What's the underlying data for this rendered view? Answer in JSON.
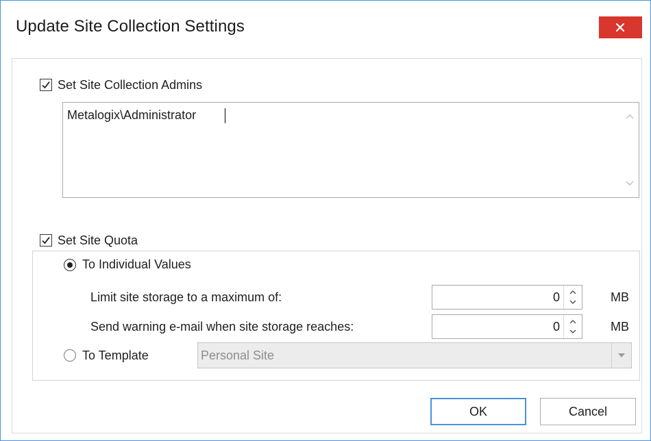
{
  "dialog": {
    "title": "Update Site Collection Settings",
    "close_label": "×"
  },
  "admins": {
    "checkbox_label": "Set Site Collection Admins",
    "checked": true,
    "value": "Metalogix\\Administrator"
  },
  "quota": {
    "checkbox_label": "Set Site Quota",
    "checked": true,
    "individual": {
      "label": "To Individual Values",
      "selected": true,
      "storage_limit_label": "Limit site storage to a maximum of:",
      "storage_limit_value": "0",
      "storage_limit_unit": "MB",
      "warning_label": "Send warning e-mail when site storage reaches:",
      "warning_value": "0",
      "warning_unit": "MB"
    },
    "template": {
      "label": "To Template",
      "selected": false,
      "selected_value": "Personal Site"
    }
  },
  "buttons": {
    "ok": "OK",
    "cancel": "Cancel"
  },
  "colors": {
    "close_red": "#d9362e",
    "accent_blue": "#4a90d9"
  }
}
